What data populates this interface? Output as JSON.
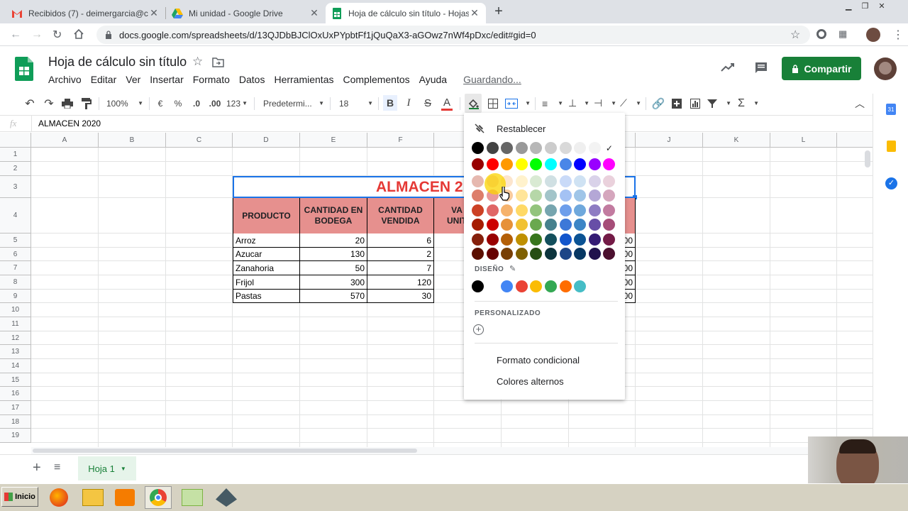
{
  "browser": {
    "tabs": [
      {
        "title": "Recibidos (7) - deimergarcia@coleg",
        "icon": "gmail-icon"
      },
      {
        "title": "Mi unidad - Google Drive",
        "icon": "drive-icon"
      },
      {
        "title": "Hoja de cálculo sin título - Hojas de",
        "icon": "sheets-icon"
      }
    ],
    "url": "docs.google.com/spreadsheets/d/13QJDbBJClOxUxPYpbtFf1jQuQaX3-aGOwz7nWf4pDxc/edit#gid=0"
  },
  "app": {
    "doc_title": "Hoja de cálculo sin título",
    "menu": [
      "Archivo",
      "Editar",
      "Ver",
      "Insertar",
      "Formato",
      "Datos",
      "Herramientas",
      "Complementos",
      "Ayuda"
    ],
    "save_status": "Guardando...",
    "share_label": "Compartir"
  },
  "toolbar": {
    "zoom": "100%",
    "currency": "€",
    "percent": "%",
    "dec_less": ".0",
    "dec_more": ".00",
    "format_more": "123",
    "font": "Predetermi...",
    "font_size": "18",
    "bold": "B",
    "italic": "I",
    "strike": "S",
    "text_color": "A"
  },
  "formula_bar": {
    "fx": "fx",
    "content": "ALMACEN 2020"
  },
  "sheet": {
    "columns": [
      "A",
      "B",
      "C",
      "D",
      "E",
      "F",
      "G",
      "H",
      "I",
      "J",
      "K",
      "L"
    ],
    "rows": [
      "1",
      "2",
      "3",
      "4",
      "5",
      "6",
      "7",
      "8",
      "9",
      "10",
      "11",
      "12",
      "13",
      "14",
      "15",
      "16",
      "17",
      "18",
      "19"
    ],
    "title_visible": "ALMACEN 2",
    "headers": [
      "PRODUCTO",
      "CANTIDAD EN BODEGA",
      "CANTIDAD VENDIDA",
      "VA UNIT"
    ],
    "data": [
      {
        "producto": "Arroz",
        "bodega": "20",
        "vendida": "6",
        "tail": "00"
      },
      {
        "producto": "Azucar",
        "bodega": "130",
        "vendida": "2",
        "tail": "00"
      },
      {
        "producto": "Zanahoria",
        "bodega": "50",
        "vendida": "7",
        "tail": "00"
      },
      {
        "producto": "Frijol",
        "bodega": "300",
        "vendida": "120",
        "tail": "00"
      },
      {
        "producto": "Pastas",
        "bodega": "570",
        "vendida": "30",
        "tail": "00"
      }
    ],
    "header_color": "#e6908e",
    "title_color": "#e53935"
  },
  "color_popup": {
    "reset_label": "Restablecer",
    "design_label": "DISEÑO",
    "custom_label": "PERSONALIZADO",
    "conditional_label": "Formato condicional",
    "alternate_label": "Colores alternos",
    "palette": [
      [
        "#000000",
        "#434343",
        "#666666",
        "#999999",
        "#b7b7b7",
        "#cccccc",
        "#d9d9d9",
        "#efefef",
        "#f3f3f3",
        "#ffffff"
      ],
      [
        "#980000",
        "#ff0000",
        "#ff9900",
        "#ffff00",
        "#00ff00",
        "#00ffff",
        "#4a86e8",
        "#0000ff",
        "#9900ff",
        "#ff00ff"
      ],
      [
        "#e6b8af",
        "#f4cccc",
        "#fce5cd",
        "#fff2cc",
        "#d9ead3",
        "#d0e0e3",
        "#c9daf8",
        "#cfe2f3",
        "#d9d2e9",
        "#ead1dc"
      ],
      [
        "#dd7e6b",
        "#ea9999",
        "#f9cb9c",
        "#ffe599",
        "#b6d7a8",
        "#a2c4c9",
        "#a4c2f4",
        "#9fc5e8",
        "#b4a7d6",
        "#d5a6bd"
      ],
      [
        "#cc4125",
        "#e06666",
        "#f6b26b",
        "#ffd966",
        "#93c47d",
        "#76a5af",
        "#6d9eeb",
        "#6fa8dc",
        "#8e7cc3",
        "#c27ba0"
      ],
      [
        "#a61c00",
        "#cc0000",
        "#e69138",
        "#f1c232",
        "#6aa84f",
        "#45818e",
        "#3c78d8",
        "#3d85c6",
        "#674ea7",
        "#a64d79"
      ],
      [
        "#85200c",
        "#990000",
        "#b45f06",
        "#bf9000",
        "#38761d",
        "#134f5c",
        "#1155cc",
        "#0b5394",
        "#351c75",
        "#741b47"
      ],
      [
        "#5b0f00",
        "#660000",
        "#783f04",
        "#7f6000",
        "#274e13",
        "#0c343d",
        "#1c4587",
        "#073763",
        "#20124d",
        "#4c1130"
      ]
    ],
    "design_colors": [
      "#000000",
      "#ffffff",
      "#4285f4",
      "#ea4335",
      "#fbbc04",
      "#34a853",
      "#ff6d01",
      "#46bdc6"
    ]
  },
  "sheet_tabs": {
    "active": "Hoja 1"
  },
  "taskbar": {
    "start": "Inicio"
  }
}
